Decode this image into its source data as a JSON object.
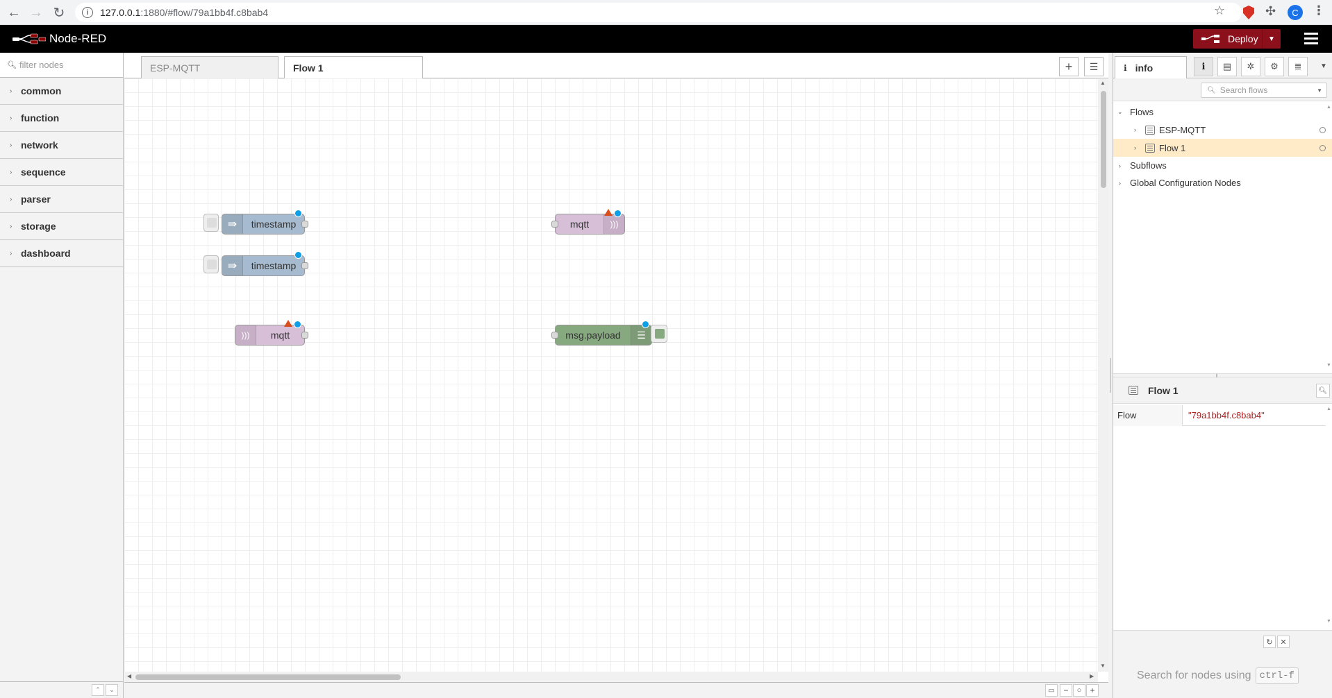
{
  "browser": {
    "url_host": "127.0.0.1",
    "url_path": ":1880/#flow/79a1bb4f.c8bab4",
    "profile_initial": "C"
  },
  "app": {
    "title": "Node-RED",
    "deploy_label": "Deploy",
    "colors": {
      "header_bg": "#000000",
      "deploy_bg": "#8c101c",
      "inject_node": "#a6bbcf",
      "mqtt_node": "#d8bfd8",
      "debug_node": "#87a980",
      "status_dot": "#0f9fe6",
      "warning": "#d94f1c",
      "selected_row": "#ffebc7"
    }
  },
  "palette": {
    "search_placeholder": "filter nodes",
    "categories": [
      "common",
      "function",
      "network",
      "sequence",
      "parser",
      "storage",
      "dashboard"
    ]
  },
  "workspace": {
    "tabs": [
      {
        "label": "ESP-MQTT",
        "active": false
      },
      {
        "label": "Flow 1",
        "active": true
      }
    ],
    "nodes": [
      {
        "type": "inject",
        "label": "timestamp",
        "icon": "arrow-right-icon"
      },
      {
        "type": "inject",
        "label": "timestamp",
        "icon": "arrow-right-icon"
      },
      {
        "type": "mqtt out",
        "label": "mqtt",
        "icon": "wifi-icon",
        "warning": true
      },
      {
        "type": "mqtt in",
        "label": "mqtt",
        "icon": "wifi-icon",
        "warning": true
      },
      {
        "type": "debug",
        "label": "msg.payload",
        "icon": "list-icon"
      }
    ]
  },
  "sidebar": {
    "active_tab": "info",
    "search_placeholder": "Search flows",
    "tree": {
      "flows_label": "Flows",
      "flows": [
        {
          "label": "ESP-MQTT",
          "selected": false
        },
        {
          "label": "Flow 1",
          "selected": true
        }
      ],
      "subflows_label": "Subflows",
      "global_config_label": "Global Configuration Nodes"
    },
    "properties": {
      "title": "Flow 1",
      "rows": [
        {
          "key": "Flow",
          "value": "\"79a1bb4f.c8bab4\""
        }
      ]
    },
    "tips": {
      "text": "Search for nodes using",
      "shortcut": "ctrl-f"
    }
  }
}
